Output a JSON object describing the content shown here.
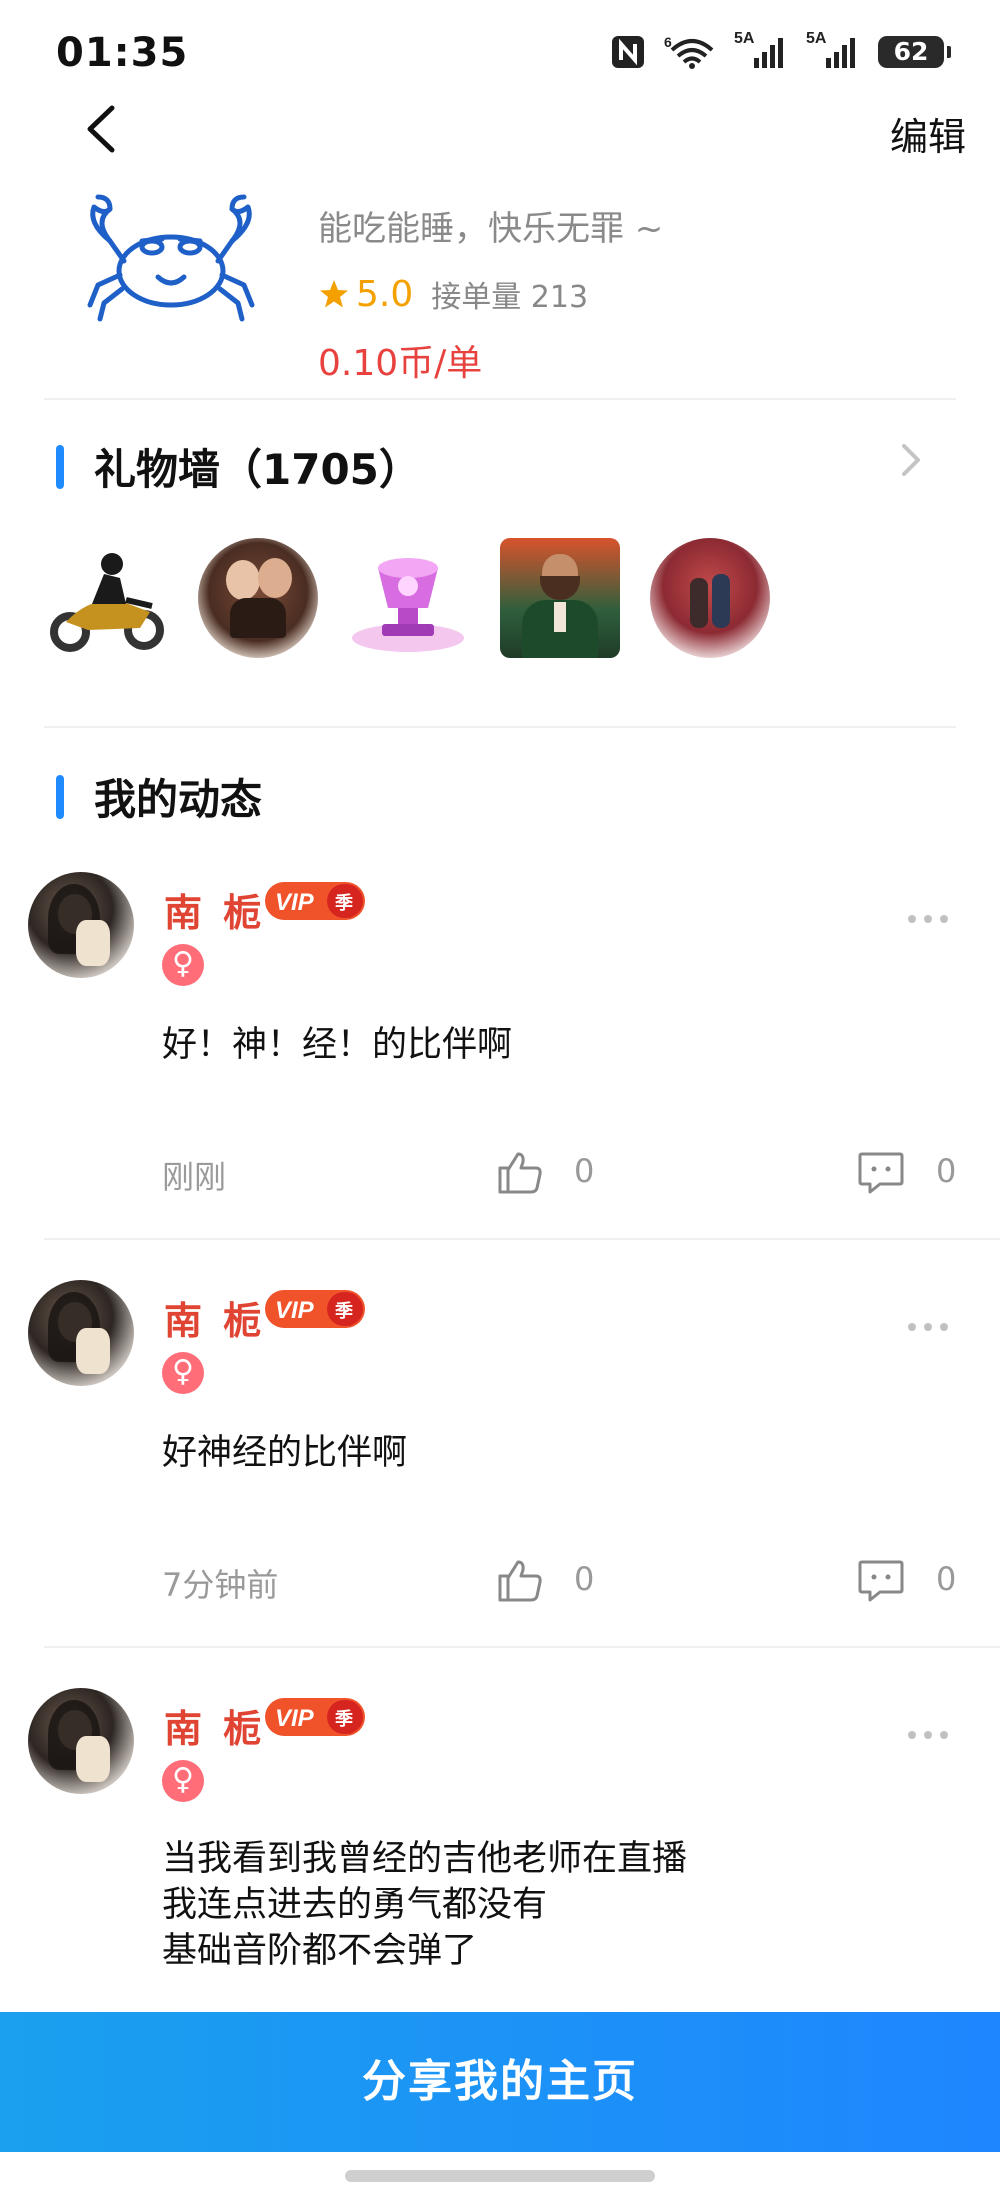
{
  "status_bar": {
    "time": "01:35",
    "network_1": "5A",
    "network_2": "5A",
    "wifi_label": "6",
    "battery": "62"
  },
  "nav": {
    "back_icon": "chevron-left-icon",
    "edit_label": "编辑"
  },
  "profile": {
    "avatar_icon": "crab-icon",
    "bio": "能吃能睡，快乐无罪 ~",
    "rating": "5.0",
    "orders_label": "接单量 213",
    "price": "0.10币/单",
    "colors": {
      "rating": "#f4a100",
      "price": "#e8423f"
    }
  },
  "gift_wall": {
    "title": "礼物墙（1705）",
    "arrow_icon": "chevron-right-icon",
    "gifts": [
      "motorcycle-rider-gift",
      "couple-portrait-gift",
      "trophy-2026-gift",
      "gentleman-portrait-gift",
      "cherry-blossom-couple-gift"
    ]
  },
  "feed": {
    "title": "我的动态",
    "accent": "#1f8bff",
    "posts": [
      {
        "name": "南 栀",
        "vip_label": "VIP",
        "vip_season": "季",
        "gender": "♀",
        "text": "好！神！经！的比伴啊",
        "time": "刚刚",
        "likes": "0",
        "comments": "0"
      },
      {
        "name": "南 栀",
        "vip_label": "VIP",
        "vip_season": "季",
        "gender": "♀",
        "text": "好神经的比伴啊",
        "time": "7分钟前",
        "likes": "0",
        "comments": "0"
      },
      {
        "name": "南 栀",
        "vip_label": "VIP",
        "vip_season": "季",
        "gender": "♀",
        "text": "当我看到我曾经的吉他老师在直播\n我连点进去的勇气都没有\n基础音阶都不会弹了"
      }
    ]
  },
  "share_button": {
    "label": "分享我的主页"
  }
}
